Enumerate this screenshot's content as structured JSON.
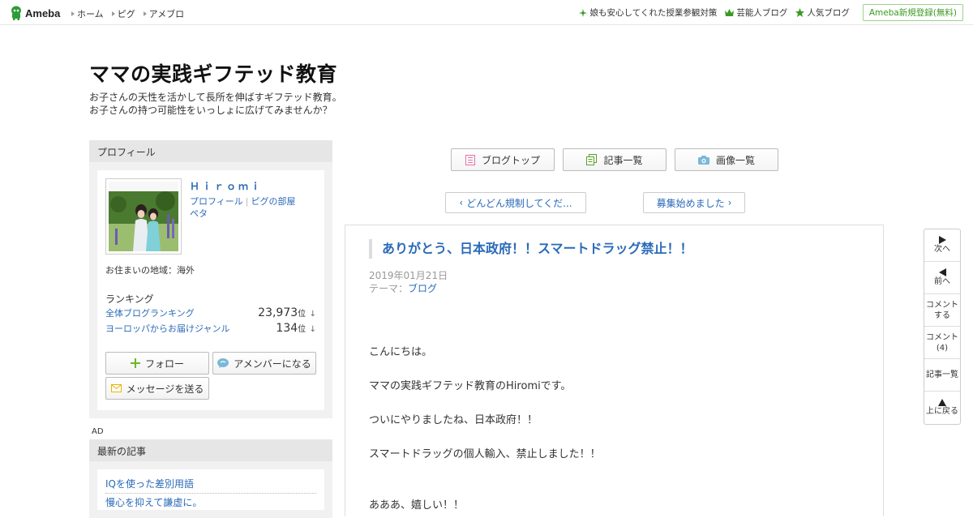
{
  "topbar": {
    "logo_text": "Ameba",
    "nav": [
      "ホーム",
      "ピグ",
      "アメブロ"
    ],
    "promos": [
      {
        "icon": "sparkle-icon",
        "label": "娘も安心してくれた授業参観対策"
      },
      {
        "icon": "crown-icon",
        "label": "芸能人ブログ"
      },
      {
        "icon": "star-icon",
        "label": "人気ブログ"
      }
    ],
    "register_label": "Ameba新規登録(無料)"
  },
  "blog": {
    "title": "ママの実践ギフテッド教育",
    "desc_line1": "お子さんの天性を活かして長所を伸ばすギフテッド教育。",
    "desc_line2": "お子さんの持つ可能性をいっしょに広げてみませんか？"
  },
  "profile": {
    "heading": "プロフィール",
    "name": "Ｈｉｒｏｍｉ",
    "link_profile": "プロフィール",
    "link_pig": "ピグの部屋",
    "link_peta": "ペタ",
    "residence": "お住まいの地域：海外",
    "ranking_label": "ランキング",
    "rankings": [
      {
        "name": "全体ブログランキング",
        "value": "23,973",
        "unit": "位",
        "arrow": "↓"
      },
      {
        "name": "ヨーロッパからお届けジャンル",
        "value": "134",
        "unit": "位",
        "arrow": "↓"
      }
    ],
    "follow_label": "フォロー",
    "amember_label": "アメンバーになる",
    "message_label": "メッセージを送る"
  },
  "ad_label": "AD",
  "recent": {
    "heading": "最新の記事",
    "items": [
      "IQを使った差別用語",
      "慢心を抑えて謙虚に。"
    ]
  },
  "tabs": {
    "top": "ブログトップ",
    "list": "記事一覧",
    "images": "画像一覧"
  },
  "pager": {
    "prev": "どんどん規制してくだ...",
    "next": "募集始めました"
  },
  "article": {
    "title": "ありがとう、日本政府！！スマートドラッグ禁止！！",
    "date": "2019年01月21日",
    "theme_label": "テーマ：",
    "theme": "ブログ",
    "paragraphs": [
      "こんにちは。",
      "ママの実践ギフテッド教育のHiromiです。",
      "ついにやりましたね、日本政府！！",
      "スマートドラッグの個人輸入、禁止しました！！",
      "あああ、嬉しい！！"
    ]
  },
  "floatnav": {
    "next": "次へ",
    "prev": "前へ",
    "comment_line1": "コメント",
    "comment_line2": "する",
    "comments_line1": "コメント",
    "comments_line2": "(4)",
    "list": "記事一覧",
    "top": "上に戻る"
  },
  "colors": {
    "accent_link": "#2a6ab8",
    "brand_green": "#3a9a22",
    "sidebar_bg": "#f1f1f1",
    "sidebar_head": "#e6e6e6"
  }
}
